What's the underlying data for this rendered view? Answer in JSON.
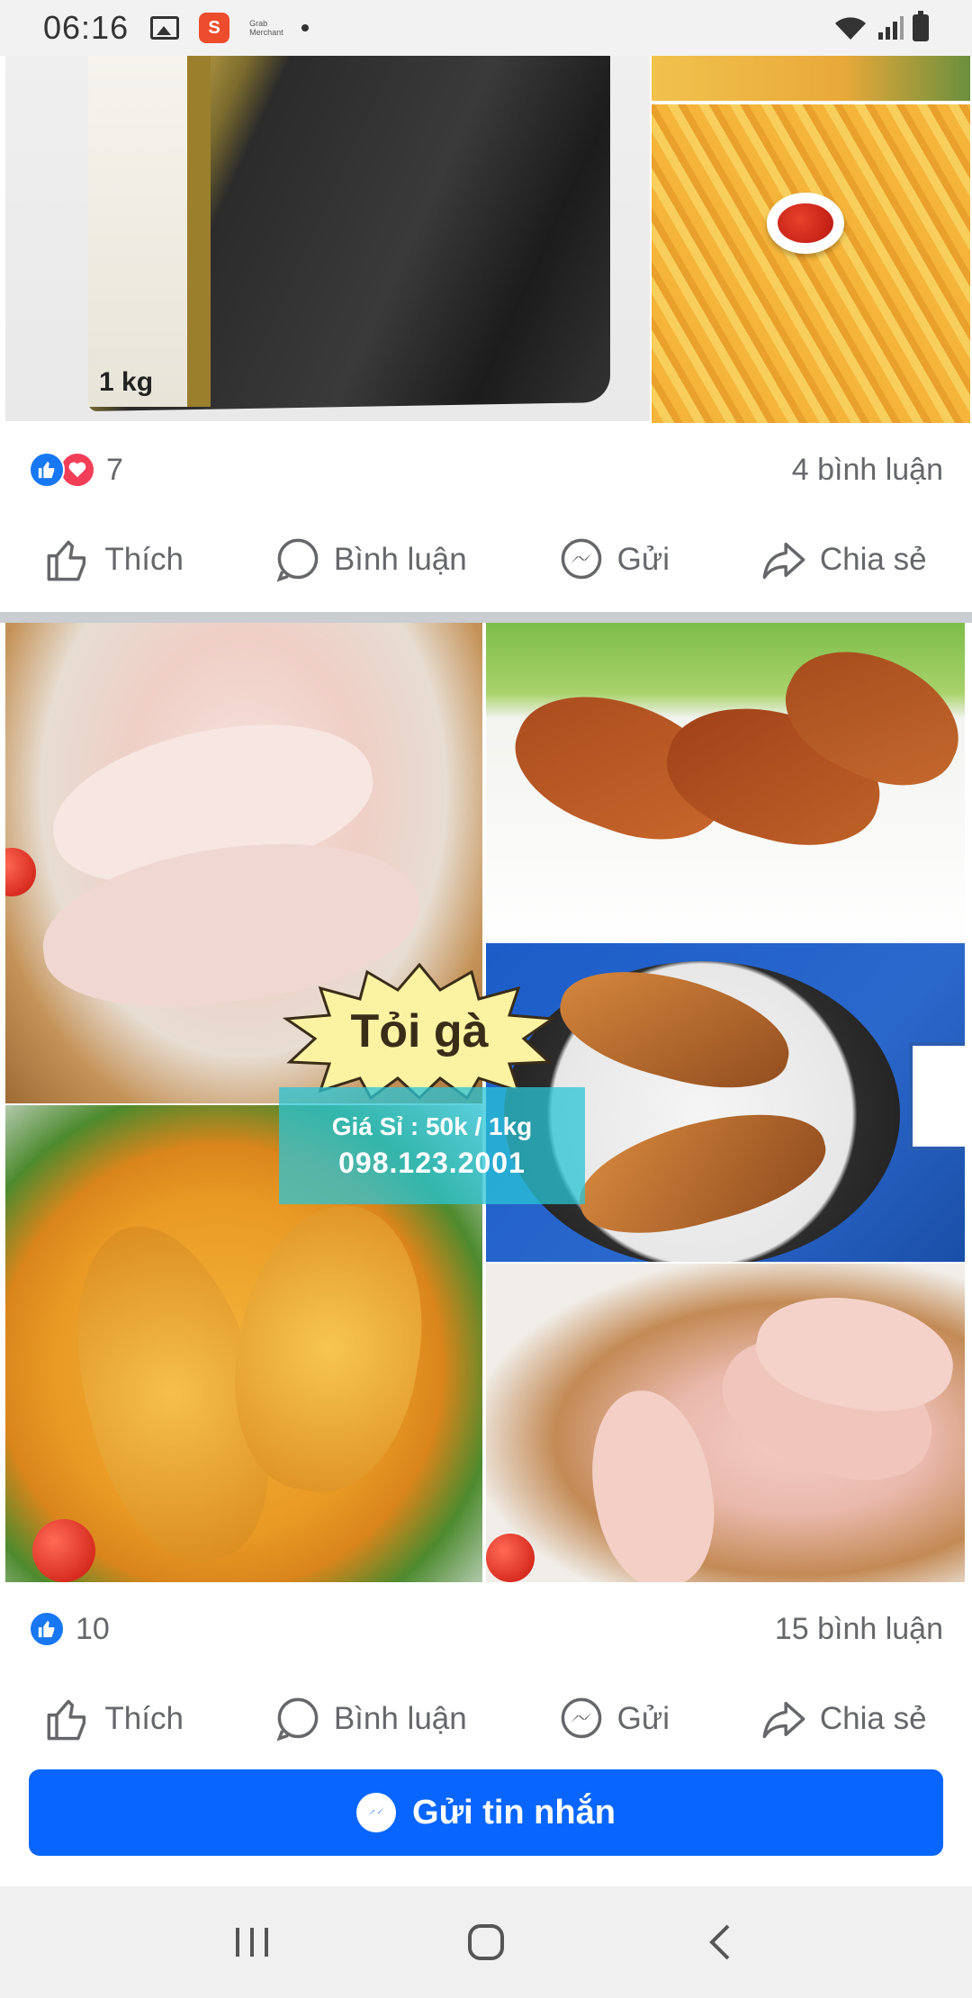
{
  "status_bar": {
    "time": "06:16",
    "notification_icons": [
      "gallery-icon",
      "shopee-icon",
      "grab-merchant-icon",
      "dot-icon"
    ],
    "shopee_label": "S",
    "grab_label": "Grab Merchant",
    "system_icons": [
      "wifi-icon",
      "signal-icon",
      "battery-icon"
    ]
  },
  "post1": {
    "images": [
      {
        "name": "frozen-fries-bag-image",
        "overlay_text": "1 kg"
      },
      {
        "name": "fries-plate-top-image"
      },
      {
        "name": "fries-with-ketchup-image"
      }
    ],
    "reaction_icons": [
      "like-reaction-icon",
      "love-reaction-icon"
    ],
    "reaction_count": "7",
    "comment_count": "4 bình luận"
  },
  "actions": {
    "like": "Thích",
    "comment": "Bình luận",
    "send": "Gửi",
    "share": "Chia sẻ"
  },
  "post2": {
    "images": [
      {
        "name": "raw-drumsticks-board-image"
      },
      {
        "name": "spicy-wings-plate-image"
      },
      {
        "name": "grilled-drumsticks-image"
      },
      {
        "name": "crispy-fried-chicken-image"
      },
      {
        "name": "raw-drumsticks-tray-image"
      }
    ],
    "overlay": {
      "title": "Tỏi gà",
      "price": "Giá Sỉ : 50k / 1kg",
      "phone": "098.123.2001"
    },
    "reaction_icons": [
      "like-reaction-icon"
    ],
    "reaction_count": "10",
    "comment_count": "15 bình luận"
  },
  "send_message_button": "Gửi tin nhắn",
  "nav_bar": [
    "recent-apps-icon",
    "home-icon",
    "back-icon"
  ],
  "colors": {
    "accent": "#0866ff",
    "like_blue": "#1877f2",
    "love_red": "#f33e58",
    "muted_text": "#65676b"
  }
}
